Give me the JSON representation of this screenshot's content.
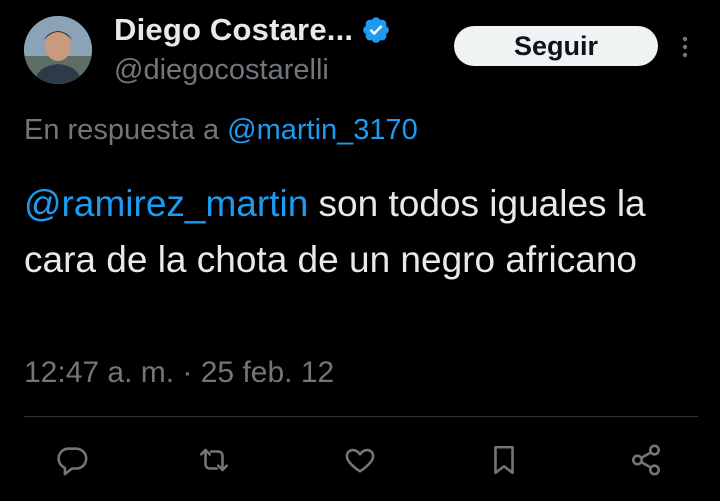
{
  "user": {
    "display_name": "Diego Costare...",
    "handle": "@diegocostarelli",
    "verified": true
  },
  "follow_button": {
    "label": "Seguir"
  },
  "reply_to": {
    "prefix": "En respuesta a ",
    "mention": "@martin_3170"
  },
  "tweet": {
    "mention": "@ramirez_martin",
    "text": " son todos iguales la cara de la chota de un negro africano",
    "timestamp": "12:47 a. m. · 25 feb. 12"
  },
  "icons": {
    "more": "more-vertical-icon",
    "reply": "reply-icon",
    "retweet": "retweet-icon",
    "like": "heart-icon",
    "bookmark": "bookmark-icon",
    "share": "share-icon",
    "verified": "verified-badge-icon"
  },
  "colors": {
    "background": "#000000",
    "text": "#e7e9ea",
    "secondary": "#71767b",
    "accent": "#1d9bf0",
    "divider": "#2f3336"
  }
}
